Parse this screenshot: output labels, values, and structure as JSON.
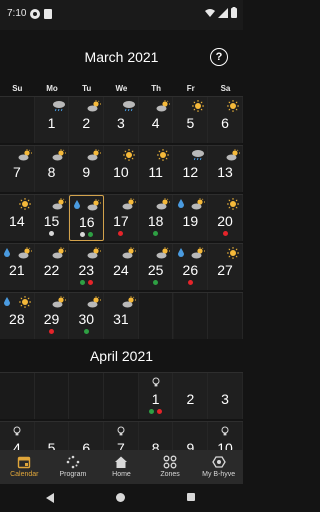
{
  "status_bar": {
    "time": "7:10"
  },
  "header": {
    "month": "March 2021",
    "help_label": "?"
  },
  "weekdays": [
    "Su",
    "Mo",
    "Tu",
    "We",
    "Th",
    "Fr",
    "Sa"
  ],
  "march": {
    "title": "March 2021",
    "weeks": [
      [
        null,
        {
          "day": "1",
          "weather": "rain-cloud"
        },
        {
          "day": "2",
          "weather": "partly-sunny"
        },
        {
          "day": "3",
          "weather": "rain-cloud"
        },
        {
          "day": "4",
          "weather": "partly-sunny"
        },
        {
          "day": "5",
          "weather": "sunny"
        },
        {
          "day": "6",
          "weather": "sunny"
        }
      ],
      [
        {
          "day": "7",
          "weather": "partly-sunny"
        },
        {
          "day": "8",
          "weather": "partly-sunny"
        },
        {
          "day": "9",
          "weather": "partly-sunny"
        },
        {
          "day": "10",
          "weather": "sunny"
        },
        {
          "day": "11",
          "weather": "sunny"
        },
        {
          "day": "12",
          "weather": "rain-cloud"
        },
        {
          "day": "13",
          "weather": "partly-sunny"
        }
      ],
      [
        {
          "day": "14",
          "weather": "sunny"
        },
        {
          "day": "15",
          "weather": "partly-sunny",
          "dots": [
            "white"
          ]
        },
        {
          "day": "16",
          "weather": "partly-sunny",
          "drop": true,
          "selected": true,
          "dots": [
            "white",
            "green"
          ]
        },
        {
          "day": "17",
          "weather": "partly-sunny",
          "dots": [
            "red"
          ]
        },
        {
          "day": "18",
          "weather": "partly-sunny",
          "dots": [
            "green"
          ]
        },
        {
          "day": "19",
          "weather": "partly-sunny",
          "drop": true
        },
        {
          "day": "20",
          "weather": "sunny",
          "dots": [
            "red"
          ]
        }
      ],
      [
        {
          "day": "21",
          "weather": "partly-sunny",
          "drop": true
        },
        {
          "day": "22",
          "weather": "partly-sunny"
        },
        {
          "day": "23",
          "weather": "partly-sunny",
          "dots": [
            "green",
            "red"
          ]
        },
        {
          "day": "24",
          "weather": "partly-sunny"
        },
        {
          "day": "25",
          "weather": "partly-sunny",
          "dots": [
            "green"
          ]
        },
        {
          "day": "26",
          "weather": "partly-sunny",
          "drop": true,
          "dots": [
            "red"
          ]
        },
        {
          "day": "27",
          "weather": "sunny"
        }
      ],
      [
        {
          "day": "28",
          "weather": "sunny",
          "drop": true
        },
        {
          "day": "29",
          "weather": "partly-sunny",
          "dots": [
            "red"
          ]
        },
        {
          "day": "30",
          "weather": "partly-sunny",
          "dots": [
            "green"
          ]
        },
        {
          "day": "31",
          "weather": "partly-sunny"
        },
        null,
        null,
        null
      ]
    ]
  },
  "april": {
    "title": "April 2021",
    "weeks": [
      [
        null,
        null,
        null,
        null,
        {
          "day": "1",
          "weather": "bulb",
          "dots": [
            "green",
            "red"
          ]
        },
        {
          "day": "2"
        },
        {
          "day": "3"
        }
      ],
      [
        {
          "day": "4",
          "weather": "bulb"
        },
        {
          "day": "5"
        },
        {
          "day": "6"
        },
        {
          "day": "7",
          "weather": "bulb"
        },
        {
          "day": "8"
        },
        {
          "day": "9"
        },
        {
          "day": "10",
          "weather": "bulb"
        }
      ]
    ]
  },
  "bottom_nav": [
    {
      "label": "Calendar",
      "icon": "calendar-icon",
      "active": true
    },
    {
      "label": "Program",
      "icon": "program-icon",
      "active": false
    },
    {
      "label": "Home",
      "icon": "home-icon",
      "active": false
    },
    {
      "label": "Zones",
      "icon": "zones-icon",
      "active": false
    },
    {
      "label": "My B-hyve",
      "icon": "bhyve-icon",
      "active": false
    }
  ],
  "colors": {
    "accent": "#e0a63a",
    "dot_green": "#2ea043",
    "dot_red": "#e5242a",
    "sun": "#f5b93a",
    "cloud": "#b9b9b9",
    "drop": "#4a9be0"
  }
}
